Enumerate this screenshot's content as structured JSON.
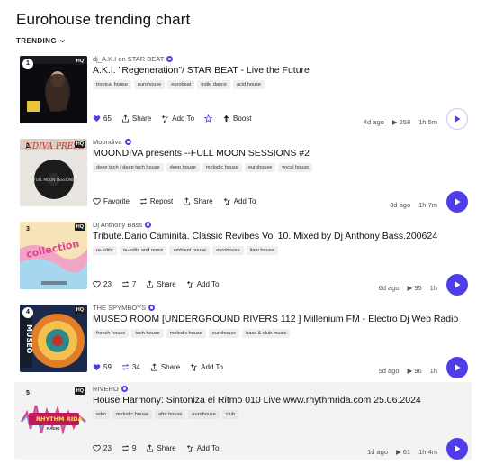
{
  "page_title": "Eurohouse trending chart",
  "filter_label": "TRENDING",
  "accent_color": "#4f3dea",
  "tracks": [
    {
      "rank": "1",
      "hq": "HQ",
      "cover_text": "LIVE",
      "artist": "dj_A.K.I on STAR BEAT",
      "title": "A.K.I. \"Regeneration\"/ STAR BEAT - Live the Future",
      "tags": [
        "tropical house",
        "eurohouse",
        "eurobeat",
        "indie dance",
        "acid house"
      ],
      "likes": "65",
      "share": "Share",
      "add_to": "Add To",
      "boost": "Boost",
      "age": "4d ago",
      "plays": "258",
      "duration": "1h 5m"
    },
    {
      "rank": "2",
      "hq": "HQ",
      "cover_text": "FULL MOON SESSIONS",
      "artist": "Moondiva",
      "title": "MOONDIVA presents --FULL MOON SESSIONS #2",
      "tags": [
        "deep tech / deep tech house",
        "deep house",
        "melodic house",
        "eurohouse",
        "vocal house"
      ],
      "favorite": "Favorite",
      "repost": "Repost",
      "share": "Share",
      "add_to": "Add To",
      "age": "3d ago",
      "duration": "1h 7m"
    },
    {
      "rank": "3",
      "hq": "HQ",
      "cover_text": "collection",
      "artist": "Dj Anthony Bass",
      "title": "Tribute.Dario Caminita. Classic Revibes Vol 10. Mixed by Dj Anthony Bass.200624",
      "tags": [
        "re-edits",
        "re-edits and remix",
        "ambient house",
        "eurohouse",
        "italo house"
      ],
      "likes": "23",
      "reposts": "7",
      "share": "Share",
      "add_to": "Add To",
      "age": "6d ago",
      "plays": "95",
      "duration": "1h"
    },
    {
      "rank": "4",
      "hq": "HQ",
      "cover_text": "MUSEO",
      "artist": "THE SPYMBOYS",
      "title": "MUSEO ROOM [UNDERGROUND RIVERS 112 ] Millenium FM - Electro Dj Web Radio",
      "tags": [
        "french house",
        "tech house",
        "melodic house",
        "eurohouse",
        "bass & club music"
      ],
      "likes": "59",
      "reposts": "34",
      "share": "Share",
      "add_to": "Add To",
      "age": "5d ago",
      "plays": "96",
      "duration": "1h"
    },
    {
      "rank": "5",
      "hq": "HQ",
      "cover_text": "RHYTHM RIDA",
      "cover_subtext": "RADIO",
      "artist": "RIVERO",
      "title": "House Harmony: Sintoniza el Ritmo 010 Live www.rhythmrida.com 25.06.2024",
      "tags": [
        "edm",
        "melodic house",
        "afro house",
        "eurohouse",
        "club"
      ],
      "likes": "23",
      "reposts": "9",
      "share": "Share",
      "add_to": "Add To",
      "age": "1d ago",
      "plays": "61",
      "duration": "1h 4m"
    }
  ]
}
